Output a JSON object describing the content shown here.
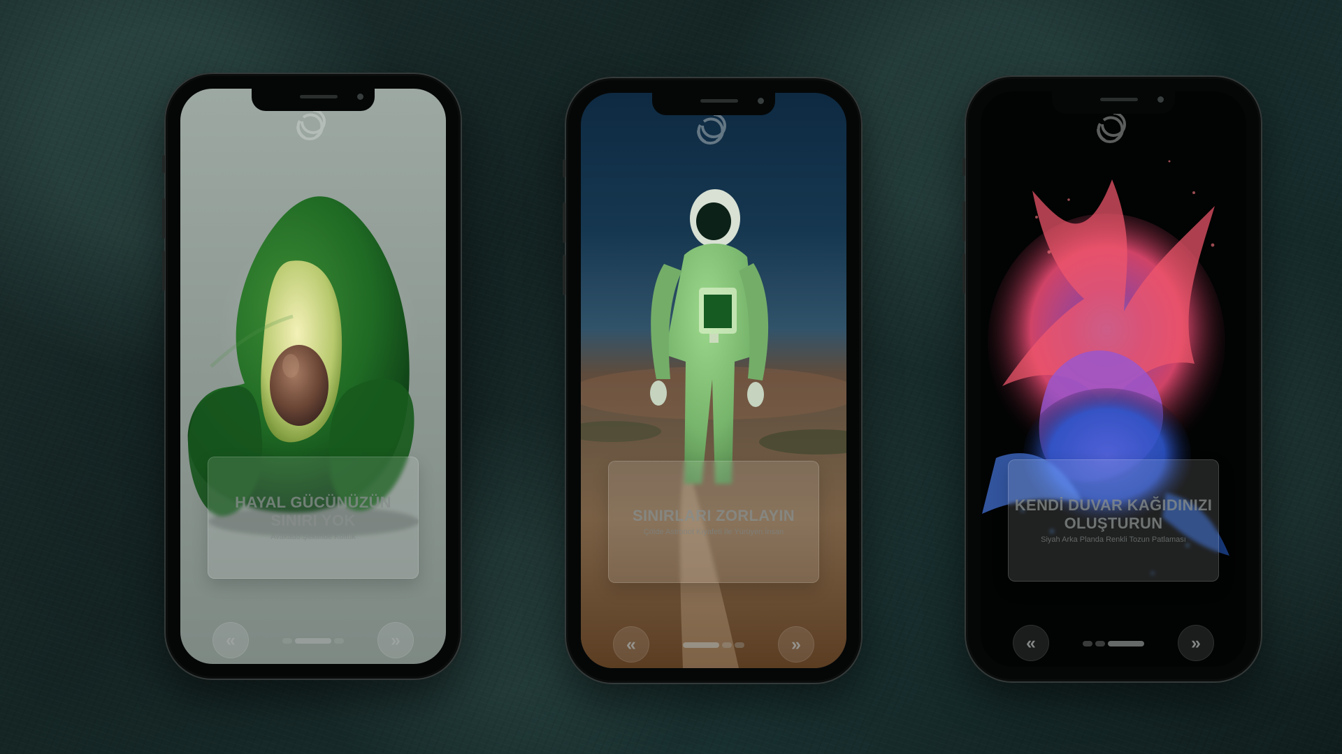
{
  "slides": [
    {
      "id": "avocado",
      "title": "HAYAL GÜCÜNÜZÜN SINIRI YOK",
      "subtitle": "Avakado Şeklinde Koltuk",
      "prev_icon": "«",
      "next_icon": "»",
      "active_indicator": 2
    },
    {
      "id": "astronaut",
      "title": "SINIRLARI ZORLAYIN",
      "subtitle": "Çölde Astronot Kıyafeti İle Yürüyen İnsan",
      "prev_icon": "«",
      "next_icon": "»",
      "active_indicator": 1
    },
    {
      "id": "wallpaper",
      "title": "KENDİ DUVAR KAĞIDINIZI OLUŞTURUN",
      "subtitle": "Siyah Arka Planda Renkli Tozun Patlaması",
      "prev_icon": "«",
      "next_icon": "»",
      "active_indicator": 3
    }
  ],
  "colors": {
    "background": "#152625",
    "phone_frame": "#050707",
    "avocado": "#1f6a24",
    "astronaut_suit": "#78b56c",
    "powder_pink": "#e64a72",
    "powder_blue": "#4b62d9"
  },
  "icons": {
    "brand": "openai-logo-icon",
    "previous": "double-chevron-left-icon",
    "next": "double-chevron-right-icon"
  }
}
